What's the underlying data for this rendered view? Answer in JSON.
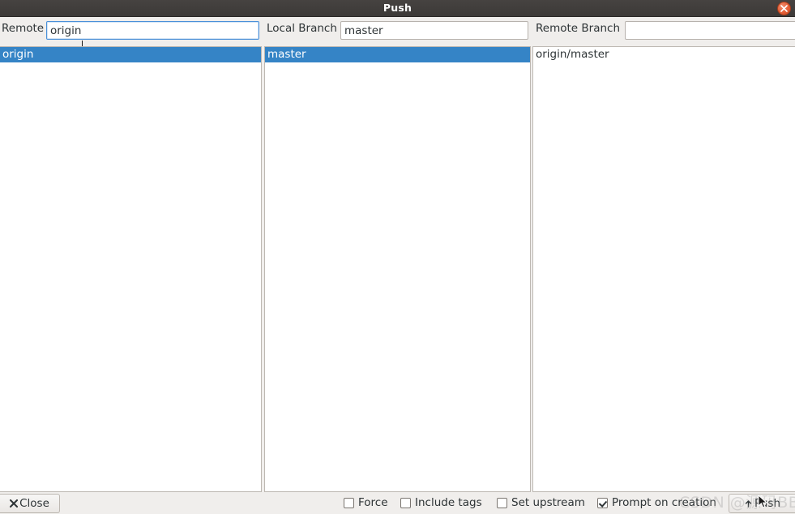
{
  "window": {
    "title": "Push",
    "close_icon": "close-icon"
  },
  "fields": {
    "remote": {
      "label": "Remote",
      "value": "origin",
      "placeholder": ""
    },
    "local_branch": {
      "label": "Local Branch",
      "value": "master",
      "placeholder": ""
    },
    "remote_branch": {
      "label": "Remote Branch",
      "value": "",
      "placeholder": ""
    }
  },
  "panes": {
    "remotes": {
      "items": [
        {
          "label": "origin",
          "selected": true
        }
      ]
    },
    "local_branches": {
      "items": [
        {
          "label": "master",
          "selected": true
        }
      ]
    },
    "remote_branches": {
      "items": [
        {
          "label": "origin/master",
          "selected": false
        }
      ]
    }
  },
  "bottom_bar": {
    "close_label": "Close",
    "close_icon": "x-icon",
    "push_label": "Push",
    "push_icon": "upload-icon",
    "checkboxes": [
      {
        "label": "Force",
        "checked": false
      },
      {
        "label": "Include tags",
        "checked": false
      },
      {
        "label": "Set upstream",
        "checked": false
      },
      {
        "label": "Prompt on creation",
        "checked": true
      }
    ]
  },
  "watermark": {
    "text": "CSDN @源码BB"
  },
  "colors": {
    "selection_blue": "#3584c6",
    "titlebar": "#3d3a38",
    "window_bg": "#f0eeec",
    "close_button": "#e35c33",
    "focus_border": "#4a90d9"
  }
}
